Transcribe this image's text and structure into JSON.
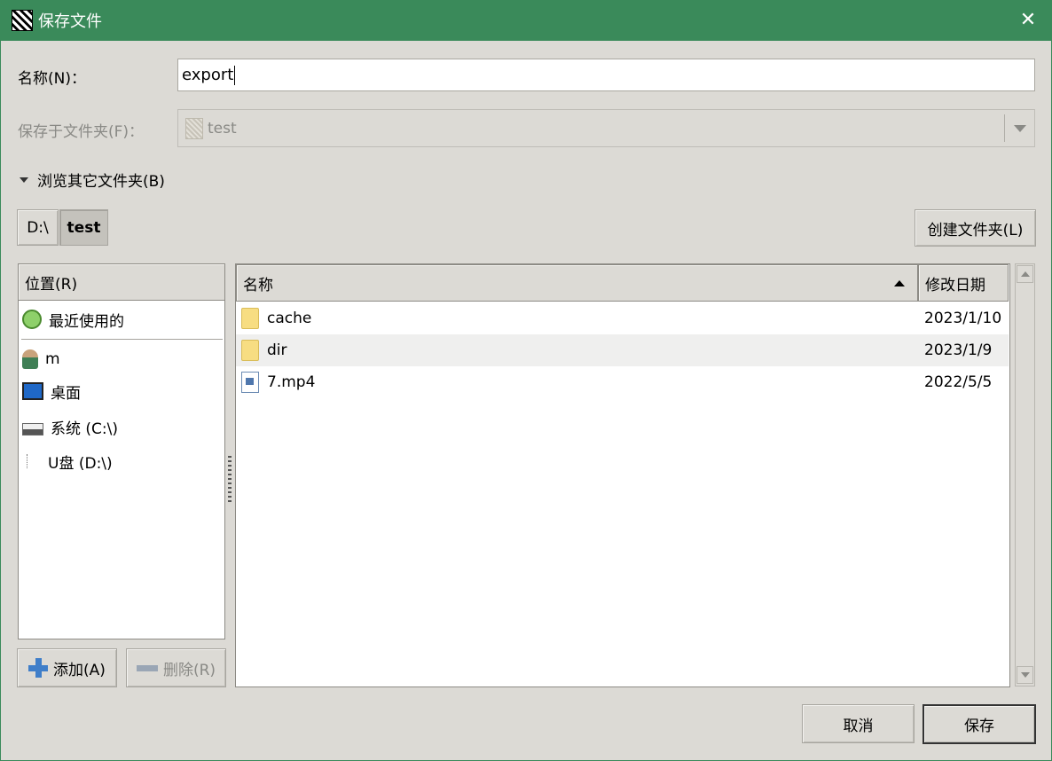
{
  "window": {
    "title": "保存文件",
    "close_glyph": "✕"
  },
  "form": {
    "name_label": "名称(N)：",
    "name_value": "export",
    "save_in_label": "保存于文件夹(F)：",
    "save_in_value": "test",
    "browse_label": "浏览其它文件夹(B)"
  },
  "path_bar": {
    "crumbs": [
      "D:\\",
      "test"
    ],
    "create_folder_label": "创建文件夹(L)"
  },
  "places": {
    "header": "位置(R)",
    "items": [
      {
        "label": "最近使用的",
        "icon": "recent-icon"
      },
      {
        "label": "m",
        "icon": "user-icon"
      },
      {
        "label": "桌面",
        "icon": "desktop-icon"
      },
      {
        "label": "系统 (C:\\)",
        "icon": "drive-icon"
      },
      {
        "label": "U盘 (D:\\)",
        "icon": "usb-drive-icon"
      }
    ],
    "add_label": "添加(A)",
    "remove_label": "删除(R)"
  },
  "files": {
    "col_name": "名称",
    "col_date": "修改日期",
    "rows": [
      {
        "name": "cache",
        "date": "2023/1/10",
        "type": "folder"
      },
      {
        "name": "dir",
        "date": "2023/1/9",
        "type": "folder"
      },
      {
        "name": "7.mp4",
        "date": "2022/5/5",
        "type": "video"
      }
    ]
  },
  "actions": {
    "cancel_label": "取消",
    "save_label": "保存"
  },
  "colors": {
    "titlebar": "#3a8a5a",
    "window_bg": "#dcdad5"
  }
}
